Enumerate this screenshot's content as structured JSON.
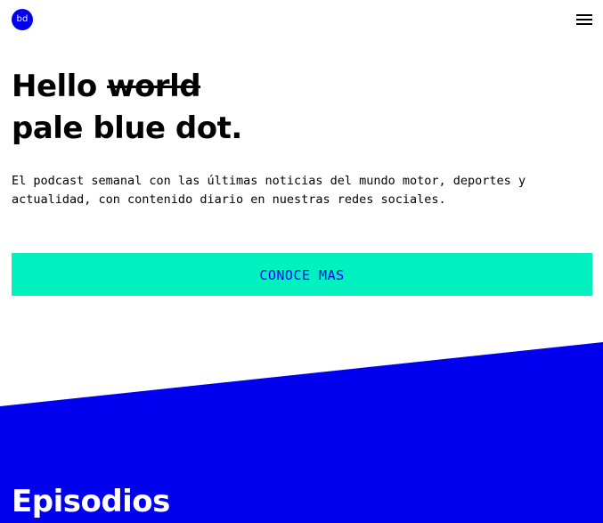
{
  "header": {
    "logo_text": "bd",
    "menu_icon": "hamburger-menu-icon"
  },
  "hero": {
    "headline_word": "Hello",
    "headline_struck": "world",
    "headline_line2": "pale blue dot.",
    "description_line1": "El podcast semanal con las últimas noticias del mundo motor, deportes y",
    "description_line2": "actualidad, con contenido diario en nuestras redes sociales.",
    "cta_label": "CONOCE MAS"
  },
  "episodes": {
    "title": "Episodios"
  },
  "colors": {
    "brand_blue": "#0000ee",
    "cta_background": "#00f0c0",
    "text": "#000000",
    "background": "#ffffff"
  }
}
